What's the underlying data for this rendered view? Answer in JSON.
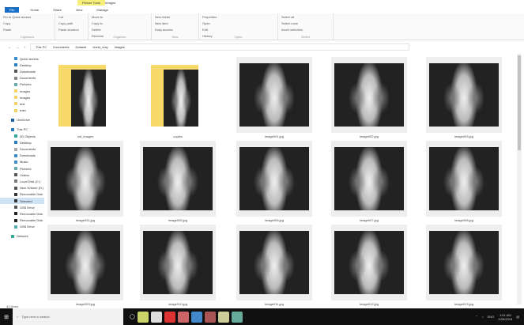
{
  "window": {
    "context_tab": "Picture Tools",
    "title": "Images"
  },
  "tabs": [
    "File",
    "Home",
    "Share",
    "View",
    "Manage"
  ],
  "ribbon": {
    "groups": [
      {
        "label": "Clipboard",
        "items": [
          "Pin to Quick access",
          "Copy",
          "Paste"
        ]
      },
      {
        "label": "",
        "items": [
          "Cut",
          "Copy path",
          "Paste shortcut"
        ]
      },
      {
        "label": "Organize",
        "items": [
          "Move to",
          "Copy to",
          "Delete",
          "Rename"
        ]
      },
      {
        "label": "New",
        "items": [
          "New folder",
          "New item",
          "Easy access"
        ]
      },
      {
        "label": "Open",
        "items": [
          "Properties",
          "Open",
          "Edit",
          "History"
        ]
      },
      {
        "label": "Select",
        "items": [
          "Select all",
          "Select none",
          "Invert selection"
        ]
      }
    ]
  },
  "address": {
    "crumbs": [
      "This PC",
      "Documents",
      "Dataset",
      "chest_xray",
      "Images"
    ]
  },
  "sidebar": {
    "items": [
      "Quick access",
      "Desktop",
      "Downloads",
      "Documents",
      "Pictures",
      "Images",
      "Images",
      "test",
      "train",
      "OneDrive",
      "This PC",
      "3D Objects",
      "Desktop",
      "Documents",
      "Downloads",
      "Music",
      "Pictures",
      "Videos",
      "Local Disk (C:)",
      "New Volume (D:)",
      "Removable Disk",
      "Selected",
      "USB Drive",
      "Removable Disk",
      "Removable Disk",
      "USB Drive",
      "Network"
    ],
    "selected_index": 21
  },
  "files": [
    {
      "name": "old_images",
      "type": "folder"
    },
    {
      "name": "copies",
      "type": "folder"
    },
    {
      "name": "image001.jpg",
      "type": "image"
    },
    {
      "name": "image002.jpg",
      "type": "image"
    },
    {
      "name": "image003.jpg",
      "type": "image"
    },
    {
      "name": "image004.jpg",
      "type": "image"
    },
    {
      "name": "image005.jpg",
      "type": "image"
    },
    {
      "name": "image006.jpg",
      "type": "image"
    },
    {
      "name": "image007.jpg",
      "type": "image"
    },
    {
      "name": "image008.jpg",
      "type": "image"
    },
    {
      "name": "image009.jpg",
      "type": "image"
    },
    {
      "name": "image010.jpg",
      "type": "image"
    },
    {
      "name": "image011.jpg",
      "type": "image"
    },
    {
      "name": "image012.jpg",
      "type": "image"
    },
    {
      "name": "image013.jpg",
      "type": "image"
    }
  ],
  "status": {
    "count": "41 items"
  },
  "taskbar": {
    "search_placeholder": "Type here to search",
    "time": "1:51 AM",
    "date": "9/26/2018",
    "lang": "ENG"
  }
}
